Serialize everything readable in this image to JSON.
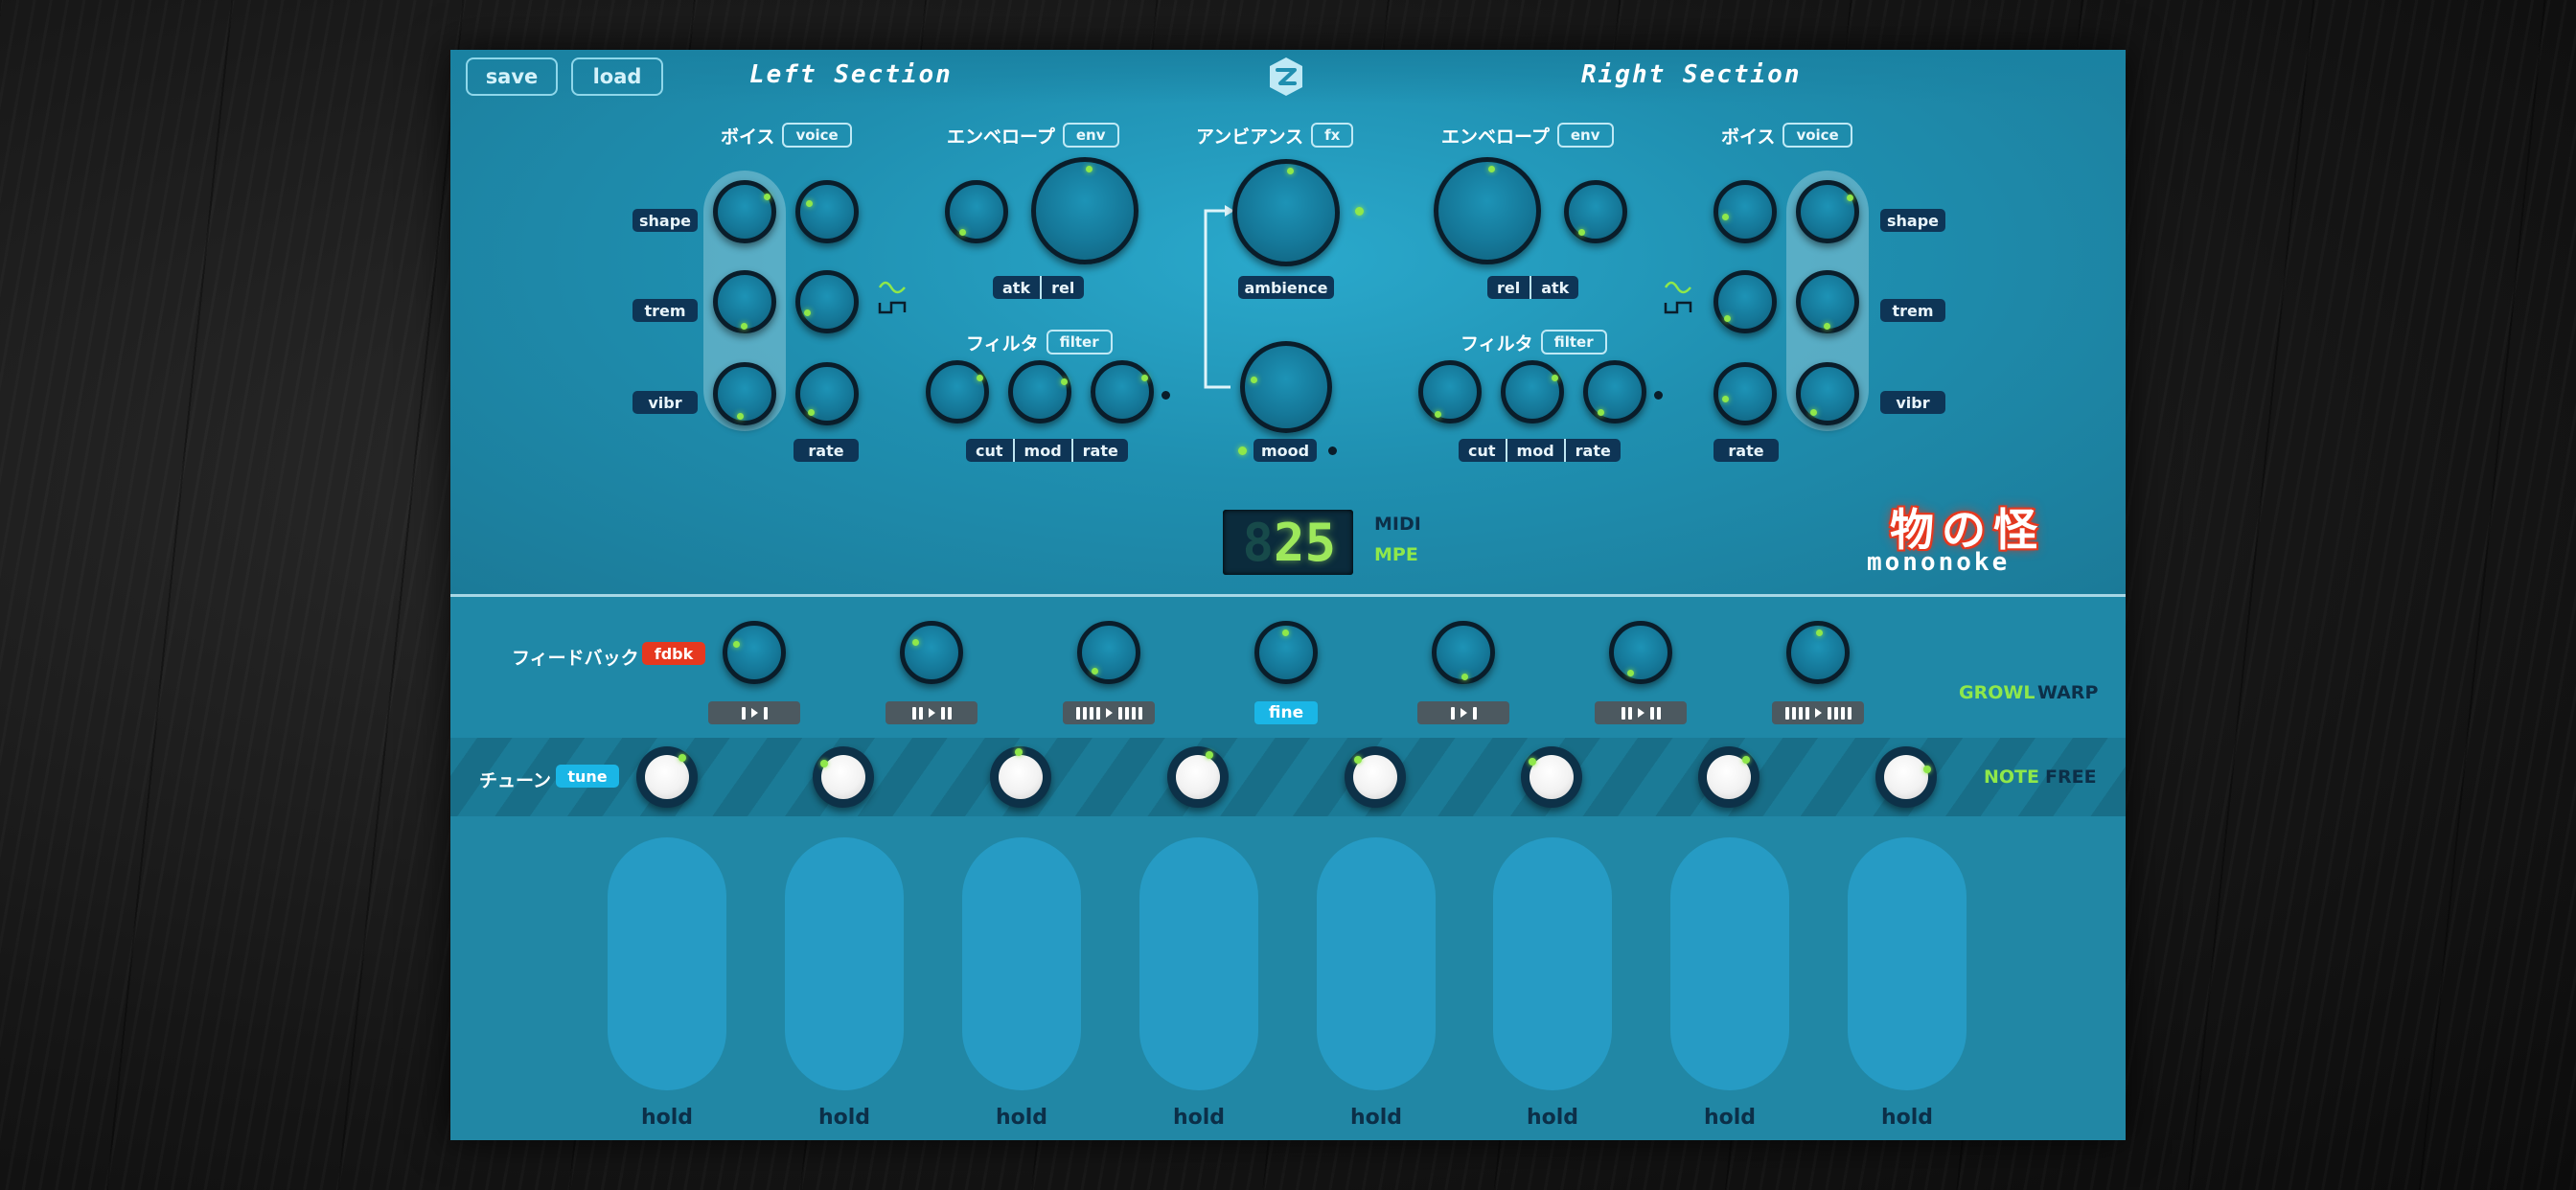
{
  "header": {
    "save_label": "save",
    "load_label": "load",
    "left_section": "Left Section",
    "right_section": "Right Section"
  },
  "left": {
    "voice_title": "ボイス",
    "voice_tag": "voice",
    "voice_labels": [
      "shape",
      "trem",
      "vibr"
    ],
    "rate_label": "rate",
    "env_title": "エンベロープ",
    "env_tag": "env",
    "env_labels": [
      "atk",
      "rel"
    ],
    "filter_title": "フィルタ",
    "filter_tag": "filter",
    "filter_labels": [
      "cut",
      "mod",
      "rate"
    ]
  },
  "center": {
    "fx_title": "アンビアンス",
    "fx_tag": "fx",
    "ambience_label": "ambience",
    "mood_label": "mood"
  },
  "right": {
    "env_title": "エンベロープ",
    "env_tag": "env",
    "env_labels": [
      "rel",
      "atk"
    ],
    "voice_title": "ボイス",
    "voice_tag": "voice",
    "voice_labels": [
      "shape",
      "trem",
      "vibr"
    ],
    "rate_label": "rate",
    "filter_title": "フィルタ",
    "filter_tag": "filter",
    "filter_labels": [
      "cut",
      "mod",
      "rate"
    ]
  },
  "display": {
    "ghost_digit": "8",
    "value": "25",
    "midi_label": "MIDI",
    "mpe_label": "MPE"
  },
  "brand": {
    "kanji": "物の怪",
    "latin": "mononoke"
  },
  "feedback": {
    "title": "フィードバック",
    "tag": "fdbk",
    "fine_label": "fine"
  },
  "tune": {
    "title": "チューン",
    "tag": "tune"
  },
  "modes": {
    "growl": "GROWL",
    "warp": "WARP",
    "note": "NOTE",
    "free": "FREE"
  },
  "pads": [
    "hold",
    "hold",
    "hold",
    "hold",
    "hold",
    "hold",
    "hold",
    "hold"
  ],
  "colors": {
    "panel": "#1f8fb0",
    "accent_green": "#8fe84a",
    "fdbk_red": "#e6381f",
    "tune_cyan": "#1ab6e6",
    "label_navy": "#0e3556"
  }
}
